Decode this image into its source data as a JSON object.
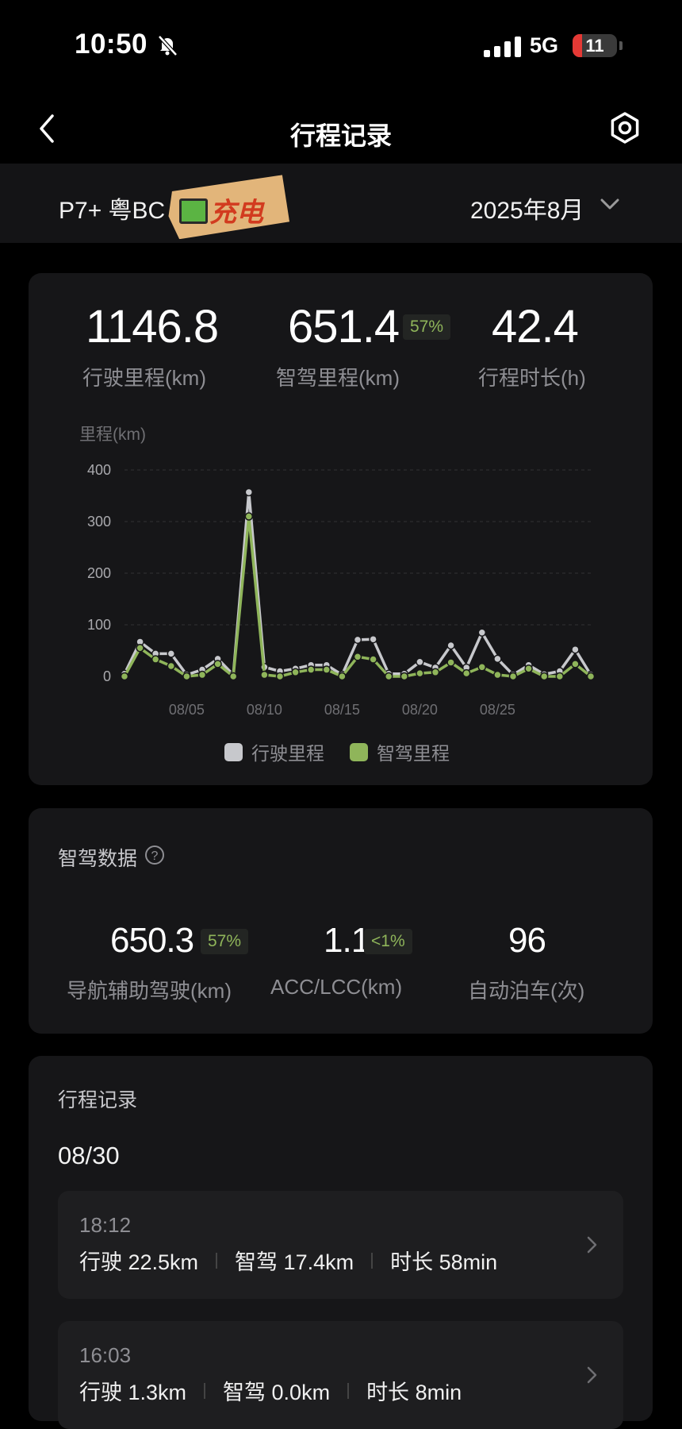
{
  "status_bar": {
    "time": "10:50",
    "network": "5G",
    "battery": "11",
    "battery_level": 0.11
  },
  "nav": {
    "title": "行程记录",
    "back_icon": "chevron-left-icon",
    "settings_icon": "gear-icon"
  },
  "vehicle": {
    "name": "P7+ 粤BC",
    "sticker_text": "充电",
    "month": "2025年8月"
  },
  "summary": {
    "drive_distance": {
      "value": "1146.8",
      "label": "行驶里程(km)"
    },
    "assist_distance": {
      "value": "651.4",
      "badge": "57%",
      "label": "智驾里程(km)"
    },
    "duration": {
      "value": "42.4",
      "label": "行程时长(h)"
    }
  },
  "chart_data": {
    "type": "line",
    "ylabel": "里程(km)",
    "ylim": [
      0,
      400
    ],
    "yticks": [
      "400",
      "300",
      "200",
      "100",
      "0"
    ],
    "x": [
      "08/01",
      "08/02",
      "08/03",
      "08/04",
      "08/05",
      "08/06",
      "08/07",
      "08/08",
      "08/09",
      "08/10",
      "08/11",
      "08/12",
      "08/13",
      "08/14",
      "08/15",
      "08/16",
      "08/17",
      "08/18",
      "08/19",
      "08/20",
      "08/21",
      "08/22",
      "08/23",
      "08/24",
      "08/25",
      "08/26",
      "08/27",
      "08/28",
      "08/29",
      "08/30",
      "08/31"
    ],
    "xticks": [
      "08/05",
      "08/10",
      "08/15",
      "08/20",
      "08/25"
    ],
    "series": [
      {
        "name": "行驶里程",
        "color": "#c7c8cc",
        "values": [
          5,
          67,
          44,
          44,
          3,
          13,
          34,
          3,
          357,
          18,
          10,
          15,
          22,
          22,
          3,
          71,
          72,
          5,
          5,
          28,
          17,
          60,
          17,
          85,
          34,
          3,
          22,
          4,
          10,
          52,
          3
        ]
      },
      {
        "name": "智驾里程",
        "color": "#8fb55a",
        "values": [
          0,
          55,
          33,
          20,
          0,
          3,
          24,
          0,
          310,
          3,
          0,
          8,
          13,
          13,
          0,
          38,
          33,
          0,
          0,
          6,
          8,
          27,
          6,
          18,
          3,
          0,
          15,
          0,
          0,
          24,
          0
        ]
      }
    ],
    "legend_position": "bottom-center",
    "grid": true
  },
  "assist_data": {
    "title": "智驾数据",
    "help_icon": "question-circle-icon",
    "nav_assist": {
      "value": "650.3",
      "badge": "57%",
      "label": "导航辅助驾驶(km)"
    },
    "acc_lcc": {
      "value": "1.1",
      "badge": "<1%",
      "label": "ACC/LCC(km)"
    },
    "auto_park": {
      "value": "96",
      "label": "自动泊车(次)"
    }
  },
  "records": {
    "title": "行程记录",
    "date": "08/30",
    "items": [
      {
        "time": "18:12",
        "drive": "行驶 22.5km",
        "assist": "智驾 17.4km",
        "duration": "时长 58min"
      },
      {
        "time": "16:03",
        "drive": "行驶 1.3km",
        "assist": "智驾 0.0km",
        "duration": "时长 8min"
      }
    ]
  }
}
